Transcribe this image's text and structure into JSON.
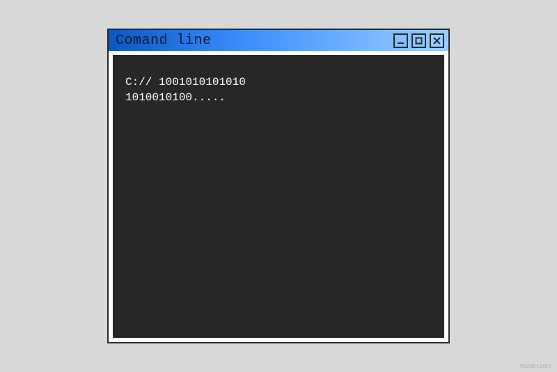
{
  "window": {
    "title": "Comand line"
  },
  "terminal": {
    "line1": "C:// 1001010101010",
    "line2": "1010010100....."
  },
  "watermark": "wsxdn.com"
}
